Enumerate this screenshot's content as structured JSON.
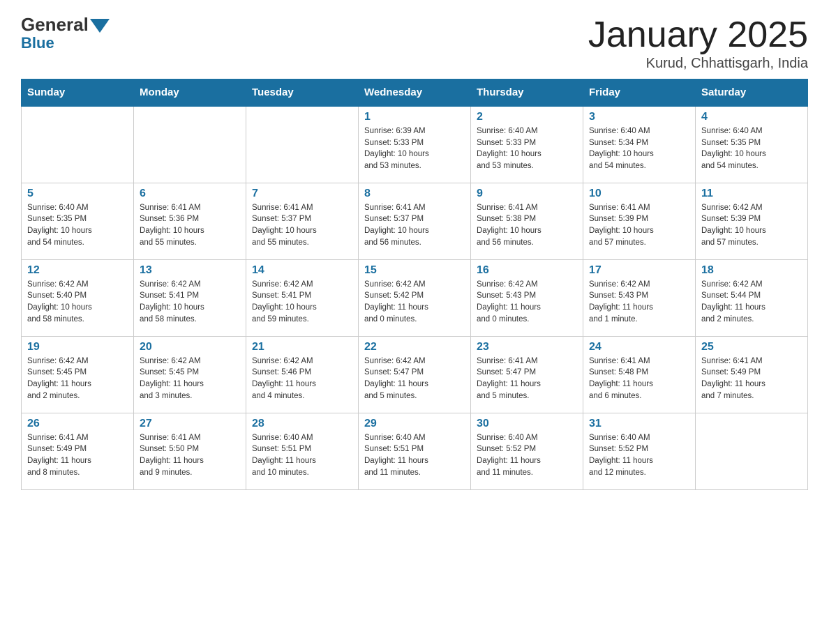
{
  "logo": {
    "general": "General",
    "blue": "Blue"
  },
  "title": "January 2025",
  "subtitle": "Kurud, Chhattisgarh, India",
  "weekdays": [
    "Sunday",
    "Monday",
    "Tuesday",
    "Wednesday",
    "Thursday",
    "Friday",
    "Saturday"
  ],
  "weeks": [
    [
      {
        "day": "",
        "info": ""
      },
      {
        "day": "",
        "info": ""
      },
      {
        "day": "",
        "info": ""
      },
      {
        "day": "1",
        "info": "Sunrise: 6:39 AM\nSunset: 5:33 PM\nDaylight: 10 hours\nand 53 minutes."
      },
      {
        "day": "2",
        "info": "Sunrise: 6:40 AM\nSunset: 5:33 PM\nDaylight: 10 hours\nand 53 minutes."
      },
      {
        "day": "3",
        "info": "Sunrise: 6:40 AM\nSunset: 5:34 PM\nDaylight: 10 hours\nand 54 minutes."
      },
      {
        "day": "4",
        "info": "Sunrise: 6:40 AM\nSunset: 5:35 PM\nDaylight: 10 hours\nand 54 minutes."
      }
    ],
    [
      {
        "day": "5",
        "info": "Sunrise: 6:40 AM\nSunset: 5:35 PM\nDaylight: 10 hours\nand 54 minutes."
      },
      {
        "day": "6",
        "info": "Sunrise: 6:41 AM\nSunset: 5:36 PM\nDaylight: 10 hours\nand 55 minutes."
      },
      {
        "day": "7",
        "info": "Sunrise: 6:41 AM\nSunset: 5:37 PM\nDaylight: 10 hours\nand 55 minutes."
      },
      {
        "day": "8",
        "info": "Sunrise: 6:41 AM\nSunset: 5:37 PM\nDaylight: 10 hours\nand 56 minutes."
      },
      {
        "day": "9",
        "info": "Sunrise: 6:41 AM\nSunset: 5:38 PM\nDaylight: 10 hours\nand 56 minutes."
      },
      {
        "day": "10",
        "info": "Sunrise: 6:41 AM\nSunset: 5:39 PM\nDaylight: 10 hours\nand 57 minutes."
      },
      {
        "day": "11",
        "info": "Sunrise: 6:42 AM\nSunset: 5:39 PM\nDaylight: 10 hours\nand 57 minutes."
      }
    ],
    [
      {
        "day": "12",
        "info": "Sunrise: 6:42 AM\nSunset: 5:40 PM\nDaylight: 10 hours\nand 58 minutes."
      },
      {
        "day": "13",
        "info": "Sunrise: 6:42 AM\nSunset: 5:41 PM\nDaylight: 10 hours\nand 58 minutes."
      },
      {
        "day": "14",
        "info": "Sunrise: 6:42 AM\nSunset: 5:41 PM\nDaylight: 10 hours\nand 59 minutes."
      },
      {
        "day": "15",
        "info": "Sunrise: 6:42 AM\nSunset: 5:42 PM\nDaylight: 11 hours\nand 0 minutes."
      },
      {
        "day": "16",
        "info": "Sunrise: 6:42 AM\nSunset: 5:43 PM\nDaylight: 11 hours\nand 0 minutes."
      },
      {
        "day": "17",
        "info": "Sunrise: 6:42 AM\nSunset: 5:43 PM\nDaylight: 11 hours\nand 1 minute."
      },
      {
        "day": "18",
        "info": "Sunrise: 6:42 AM\nSunset: 5:44 PM\nDaylight: 11 hours\nand 2 minutes."
      }
    ],
    [
      {
        "day": "19",
        "info": "Sunrise: 6:42 AM\nSunset: 5:45 PM\nDaylight: 11 hours\nand 2 minutes."
      },
      {
        "day": "20",
        "info": "Sunrise: 6:42 AM\nSunset: 5:45 PM\nDaylight: 11 hours\nand 3 minutes."
      },
      {
        "day": "21",
        "info": "Sunrise: 6:42 AM\nSunset: 5:46 PM\nDaylight: 11 hours\nand 4 minutes."
      },
      {
        "day": "22",
        "info": "Sunrise: 6:42 AM\nSunset: 5:47 PM\nDaylight: 11 hours\nand 5 minutes."
      },
      {
        "day": "23",
        "info": "Sunrise: 6:41 AM\nSunset: 5:47 PM\nDaylight: 11 hours\nand 5 minutes."
      },
      {
        "day": "24",
        "info": "Sunrise: 6:41 AM\nSunset: 5:48 PM\nDaylight: 11 hours\nand 6 minutes."
      },
      {
        "day": "25",
        "info": "Sunrise: 6:41 AM\nSunset: 5:49 PM\nDaylight: 11 hours\nand 7 minutes."
      }
    ],
    [
      {
        "day": "26",
        "info": "Sunrise: 6:41 AM\nSunset: 5:49 PM\nDaylight: 11 hours\nand 8 minutes."
      },
      {
        "day": "27",
        "info": "Sunrise: 6:41 AM\nSunset: 5:50 PM\nDaylight: 11 hours\nand 9 minutes."
      },
      {
        "day": "28",
        "info": "Sunrise: 6:40 AM\nSunset: 5:51 PM\nDaylight: 11 hours\nand 10 minutes."
      },
      {
        "day": "29",
        "info": "Sunrise: 6:40 AM\nSunset: 5:51 PM\nDaylight: 11 hours\nand 11 minutes."
      },
      {
        "day": "30",
        "info": "Sunrise: 6:40 AM\nSunset: 5:52 PM\nDaylight: 11 hours\nand 11 minutes."
      },
      {
        "day": "31",
        "info": "Sunrise: 6:40 AM\nSunset: 5:52 PM\nDaylight: 11 hours\nand 12 minutes."
      },
      {
        "day": "",
        "info": ""
      }
    ]
  ]
}
